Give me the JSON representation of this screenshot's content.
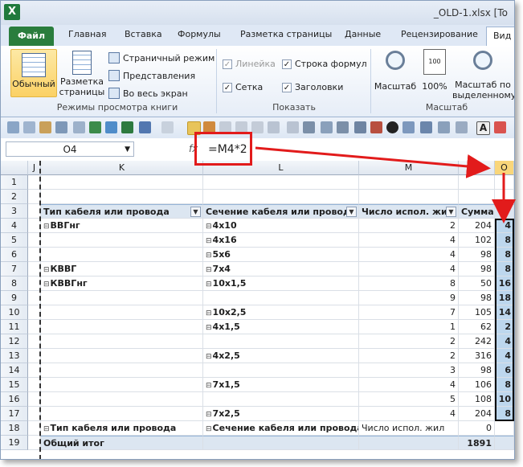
{
  "window": {
    "title": "_OLD-1.xlsx  [To"
  },
  "tabs": [
    "Файл",
    "Главная",
    "Вставка",
    "Формулы",
    "Разметка страницы",
    "Данные",
    "Рецензирование",
    "Вид"
  ],
  "ribbon": {
    "view_modes": {
      "normal": "Обычный",
      "page_layout": "Разметка страницы",
      "page_break": "Страничный режим",
      "views": "Представления",
      "fullscreen": "Во весь экран",
      "group_label": "Режимы просмотра книги"
    },
    "show": {
      "ruler": "Линейка",
      "formula_bar": "Строка формул",
      "gridlines": "Сетка",
      "headings": "Заголовки",
      "group_label": "Показать"
    },
    "zoom": {
      "zoom": "Масштаб",
      "hundred": "100%",
      "selection": "Масштаб по выделенному",
      "group_label": "Масштаб"
    }
  },
  "formula_bar": {
    "name_box": "O4",
    "fx": "fx",
    "formula": "=M4*2"
  },
  "columns": {
    "j": "J",
    "k": "K",
    "l": "L",
    "m": "M",
    "n": "N",
    "o": "O"
  },
  "rows": {
    "labels": [
      "1",
      "2",
      "3",
      "4",
      "5",
      "6",
      "7",
      "8",
      "9",
      "10",
      "11",
      "12",
      "13",
      "14",
      "15",
      "16",
      "17",
      "18",
      "19"
    ],
    "header": {
      "k": "Тип кабеля или провода",
      "l": "Сечение кабеля или провода",
      "m": "Число испол. жил",
      "n": "Сумма"
    },
    "data": [
      {
        "k": "ВВГнг",
        "k_exp": "⊟",
        "l": "4x10",
        "l_exp": "⊟",
        "m": "2",
        "n": "204",
        "o": "4"
      },
      {
        "k": "",
        "k_exp": "",
        "l": "4x16",
        "l_exp": "⊟",
        "m": "4",
        "n": "102",
        "o": "8"
      },
      {
        "k": "",
        "k_exp": "",
        "l": "5x6",
        "l_exp": "⊟",
        "m": "4",
        "n": "98",
        "o": "8"
      },
      {
        "k": "КВВГ",
        "k_exp": "⊟",
        "l": "7x4",
        "l_exp": "⊟",
        "m": "4",
        "n": "98",
        "o": "8"
      },
      {
        "k": "КВВГнг",
        "k_exp": "⊟",
        "l": "10x1,5",
        "l_exp": "⊟",
        "m": "8",
        "n": "50",
        "o": "16"
      },
      {
        "k": "",
        "k_exp": "",
        "l": "",
        "l_exp": "",
        "m": "9",
        "n": "98",
        "o": "18"
      },
      {
        "k": "",
        "k_exp": "",
        "l": "10x2,5",
        "l_exp": "⊟",
        "m": "7",
        "n": "105",
        "o": "14"
      },
      {
        "k": "",
        "k_exp": "",
        "l": "4x1,5",
        "l_exp": "⊟",
        "m": "1",
        "n": "62",
        "o": "2"
      },
      {
        "k": "",
        "k_exp": "",
        "l": "",
        "l_exp": "",
        "m": "2",
        "n": "242",
        "o": "4"
      },
      {
        "k": "",
        "k_exp": "",
        "l": "4x2,5",
        "l_exp": "⊟",
        "m": "2",
        "n": "316",
        "o": "4"
      },
      {
        "k": "",
        "k_exp": "",
        "l": "",
        "l_exp": "",
        "m": "3",
        "n": "98",
        "o": "6"
      },
      {
        "k": "",
        "k_exp": "",
        "l": "7x1,5",
        "l_exp": "⊟",
        "m": "4",
        "n": "106",
        "o": "8"
      },
      {
        "k": "",
        "k_exp": "",
        "l": "",
        "l_exp": "",
        "m": "5",
        "n": "108",
        "o": "10"
      },
      {
        "k": "",
        "k_exp": "",
        "l": "7x2,5",
        "l_exp": "⊟",
        "m": "4",
        "n": "204",
        "o": "8"
      }
    ],
    "row18": {
      "k": "Тип кабеля или провода",
      "l": "Сечение кабеля или провода",
      "m": "Число испол. жил",
      "n": "0"
    },
    "total": {
      "k": "Общий итог",
      "n": "1891"
    }
  },
  "colors": {
    "excel_green": "#2a7d3d",
    "highlight": "#bdd7ee",
    "arrow": "#e21b1b"
  }
}
